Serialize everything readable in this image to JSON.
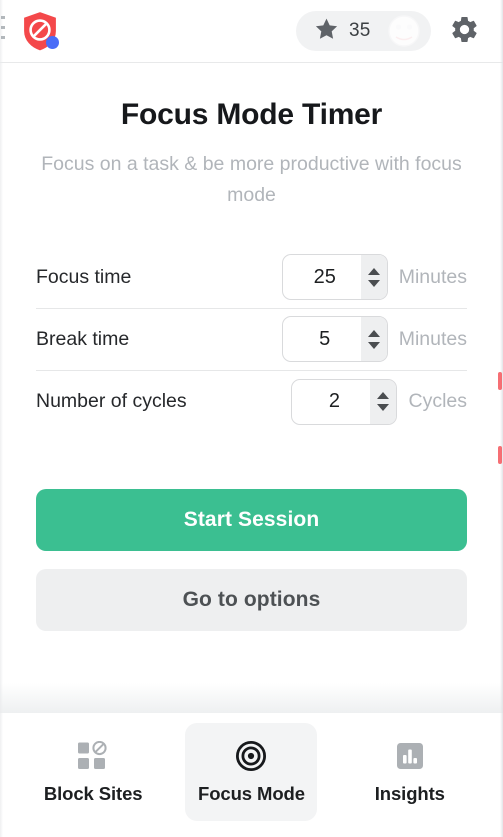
{
  "header": {
    "logo_icon": "shield-block-icon",
    "logo_badge_color": "#4a6cf7",
    "logo_color": "#f4484a",
    "points": {
      "icon": "star-icon",
      "count": "35",
      "avatar_icon": "avatar-image"
    },
    "settings_icon": "gear-icon"
  },
  "main": {
    "title": "Focus Mode Timer",
    "subtitle": "Focus on a task & be more productive with focus mode",
    "settings": [
      {
        "label": "Focus time",
        "value": "25",
        "unit": "Minutes",
        "name": "focus-time"
      },
      {
        "label": "Break time",
        "value": "5",
        "unit": "Minutes",
        "name": "break-time"
      },
      {
        "label": "Number of cycles",
        "value": "2",
        "unit": "Cycles",
        "name": "number-of-cycles"
      }
    ],
    "primary_button": "Start Session",
    "secondary_button": "Go to options",
    "primary_button_color": "#3bbf91",
    "secondary_button_color": "#eeeff0"
  },
  "nav": {
    "items": [
      {
        "label": "Block Sites",
        "icon": "block-sites-icon",
        "active": false
      },
      {
        "label": "Focus Mode",
        "icon": "target-icon",
        "active": true
      },
      {
        "label": "Insights",
        "icon": "bar-chart-icon",
        "active": false
      }
    ]
  }
}
